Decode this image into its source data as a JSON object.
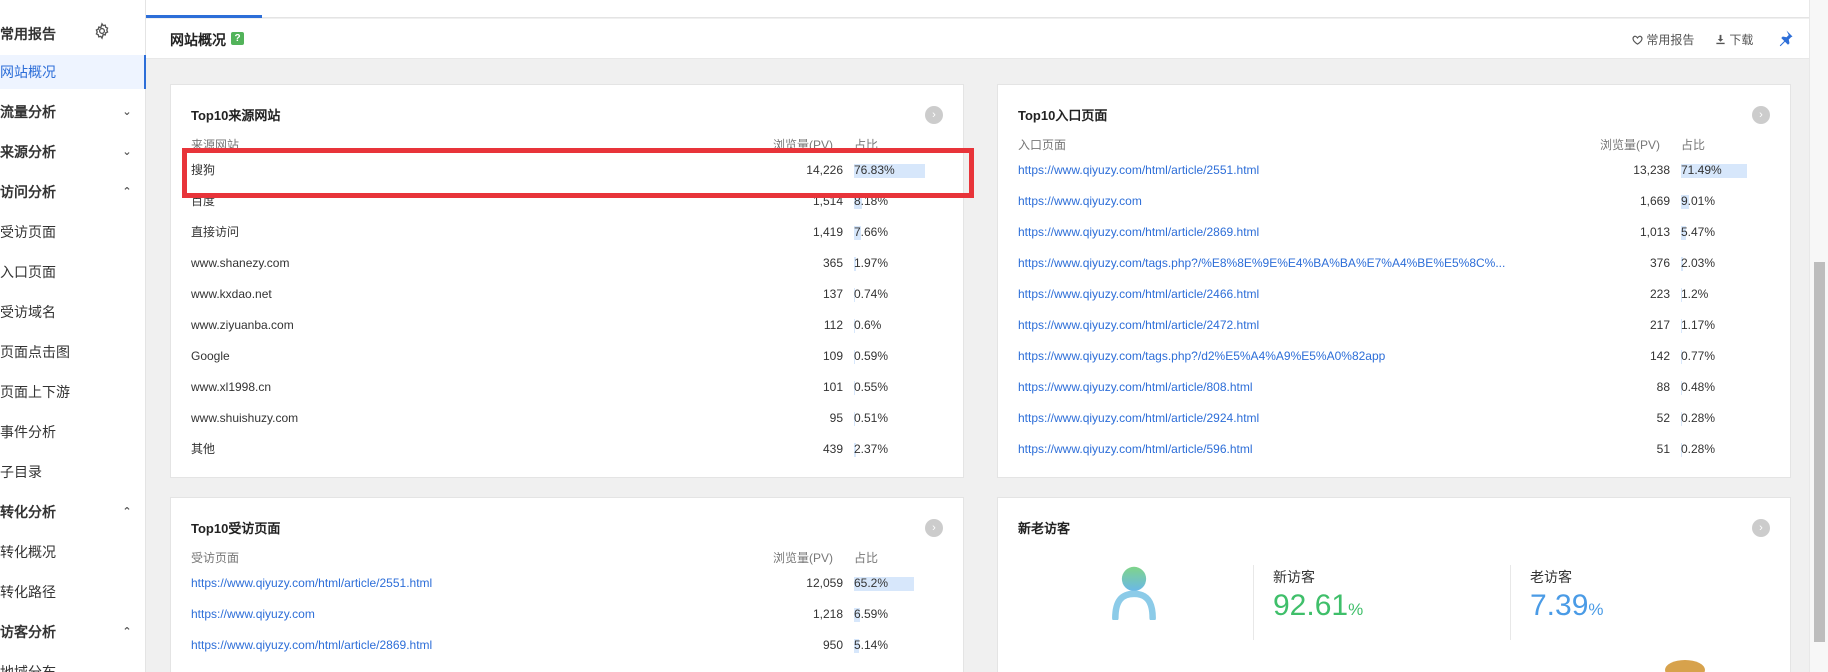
{
  "sidebar": {
    "header": "常用报告",
    "items": [
      {
        "label": "网站概况",
        "type": "active"
      },
      {
        "label": "流量分析",
        "type": "group",
        "chevron": "down"
      },
      {
        "label": "来源分析",
        "type": "group",
        "chevron": "down"
      },
      {
        "label": "访问分析",
        "type": "group",
        "chevron": "up"
      },
      {
        "label": "受访页面",
        "type": "sub"
      },
      {
        "label": "入口页面",
        "type": "sub"
      },
      {
        "label": "受访域名",
        "type": "sub"
      },
      {
        "label": "页面点击图",
        "type": "sub"
      },
      {
        "label": "页面上下游",
        "type": "sub"
      },
      {
        "label": "事件分析",
        "type": "sub"
      },
      {
        "label": "子目录",
        "type": "sub"
      },
      {
        "label": "转化分析",
        "type": "group",
        "chevron": "up"
      },
      {
        "label": "转化概况",
        "type": "sub"
      },
      {
        "label": "转化路径",
        "type": "sub"
      },
      {
        "label": "访客分析",
        "type": "group",
        "chevron": "up"
      },
      {
        "label": "地域分布",
        "type": "sub"
      }
    ]
  },
  "header": {
    "title": "网站概况",
    "help": "?",
    "fav_label": "常用报告",
    "download_label": "下载"
  },
  "top_sources": {
    "title": "Top10来源网站",
    "col_name": "来源网站",
    "col_pv": "浏览量(PV)",
    "col_pct": "占比",
    "rows": [
      {
        "name": "搜狗",
        "pv": "14,226",
        "pct": "76.83%",
        "share": 76.83
      },
      {
        "name": "百度",
        "pv": "1,514",
        "pct": "8.18%",
        "share": 8.18
      },
      {
        "name": "直接访问",
        "pv": "1,419",
        "pct": "7.66%",
        "share": 7.66
      },
      {
        "name": "www.shanezy.com",
        "pv": "365",
        "pct": "1.97%",
        "share": 1.97
      },
      {
        "name": "www.kxdao.net",
        "pv": "137",
        "pct": "0.74%",
        "share": 0.74
      },
      {
        "name": "www.ziyuanba.com",
        "pv": "112",
        "pct": "0.6%",
        "share": 0.6
      },
      {
        "name": "Google",
        "pv": "109",
        "pct": "0.59%",
        "share": 0.59
      },
      {
        "name": "www.xl1998.cn",
        "pv": "101",
        "pct": "0.55%",
        "share": 0.55
      },
      {
        "name": "www.shuishuzy.com",
        "pv": "95",
        "pct": "0.51%",
        "share": 0.51
      },
      {
        "name": "其他",
        "pv": "439",
        "pct": "2.37%",
        "share": 2.37
      }
    ]
  },
  "top_entry": {
    "title": "Top10入口页面",
    "col_name": "入口页面",
    "col_pv": "浏览量(PV)",
    "col_pct": "占比",
    "rows": [
      {
        "name": "https://www.qiyuzy.com/html/article/2551.html",
        "pv": "13,238",
        "pct": "71.49%",
        "share": 71.49
      },
      {
        "name": "https://www.qiyuzy.com",
        "pv": "1,669",
        "pct": "9.01%",
        "share": 9.01
      },
      {
        "name": "https://www.qiyuzy.com/html/article/2869.html",
        "pv": "1,013",
        "pct": "5.47%",
        "share": 5.47
      },
      {
        "name": "https://www.qiyuzy.com/tags.php?/%E8%8E%9E%E4%BA%BA%E7%A4%BE%E5%8C%...",
        "pv": "376",
        "pct": "2.03%",
        "share": 2.03
      },
      {
        "name": "https://www.qiyuzy.com/html/article/2466.html",
        "pv": "223",
        "pct": "1.2%",
        "share": 1.2
      },
      {
        "name": "https://www.qiyuzy.com/html/article/2472.html",
        "pv": "217",
        "pct": "1.17%",
        "share": 1.17
      },
      {
        "name": "https://www.qiyuzy.com/tags.php?/d2%E5%A4%A9%E5%A0%82app",
        "pv": "142",
        "pct": "0.77%",
        "share": 0.77
      },
      {
        "name": "https://www.qiyuzy.com/html/article/808.html",
        "pv": "88",
        "pct": "0.48%",
        "share": 0.48
      },
      {
        "name": "https://www.qiyuzy.com/html/article/2924.html",
        "pv": "52",
        "pct": "0.28%",
        "share": 0.28
      },
      {
        "name": "https://www.qiyuzy.com/html/article/596.html",
        "pv": "51",
        "pct": "0.28%",
        "share": 0.28
      }
    ]
  },
  "top_visited": {
    "title": "Top10受访页面",
    "col_name": "受访页面",
    "col_pv": "浏览量(PV)",
    "col_pct": "占比",
    "rows": [
      {
        "name": "https://www.qiyuzy.com/html/article/2551.html",
        "pv": "12,059",
        "pct": "65.2%",
        "share": 65.2
      },
      {
        "name": "https://www.qiyuzy.com",
        "pv": "1,218",
        "pct": "6.59%",
        "share": 6.59
      },
      {
        "name": "https://www.qiyuzy.com/html/article/2869.html",
        "pv": "950",
        "pct": "5.14%",
        "share": 5.14
      }
    ]
  },
  "visitors": {
    "title": "新老访客",
    "new_label": "新访客",
    "new_value": "92.61",
    "new_unit": "%",
    "old_label": "老访客",
    "old_value": "7.39",
    "old_unit": "%"
  },
  "colors": {
    "accent": "#2d6ed8",
    "link": "#2d6ed8",
    "bar": "#d7e7fb",
    "highlight": "#e8343a",
    "new_visitor": "#3fbf6a",
    "old_visitor": "#4a9be6"
  },
  "icons": {
    "settings": "gear-icon",
    "help": "help-icon",
    "favorite": "heart-icon",
    "download": "download-icon",
    "pin": "pin-icon",
    "more": "chevron-right-icon",
    "visitor": "user-icon"
  }
}
